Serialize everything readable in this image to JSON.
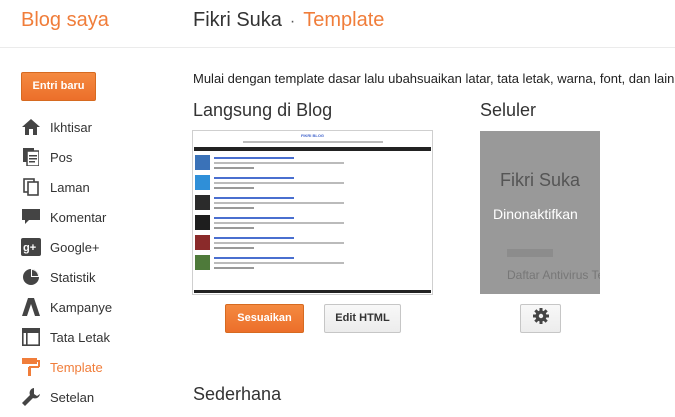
{
  "header": {
    "brand": "Blog saya",
    "blog_name": "Fikri Suka",
    "separator": "·",
    "current_page": "Template"
  },
  "sidebar": {
    "new_post_label": "Entri baru",
    "items": [
      {
        "label": "Ikhtisar",
        "icon": "home-icon"
      },
      {
        "label": "Pos",
        "icon": "posts-icon"
      },
      {
        "label": "Laman",
        "icon": "pages-icon"
      },
      {
        "label": "Komentar",
        "icon": "comment-icon"
      },
      {
        "label": "Google+",
        "icon": "google-plus-icon"
      },
      {
        "label": "Statistik",
        "icon": "pie-chart-icon"
      },
      {
        "label": "Kampanye",
        "icon": "adwords-icon"
      },
      {
        "label": "Tata Letak",
        "icon": "layout-icon"
      },
      {
        "label": "Template",
        "icon": "paint-roller-icon"
      },
      {
        "label": "Setelan",
        "icon": "wrench-icon"
      }
    ],
    "active_item": "Template"
  },
  "main": {
    "intro": "Mulai dengan template dasar lalu ubahsuaikan latar, tata letak, warna, font, dan lain",
    "live_title": "Langsung di Blog",
    "mobile_title": "Seluler",
    "simple_title": "Sederhana",
    "preview": {
      "blog_title": "FIKRI BLOG"
    },
    "mobile_preview": {
      "title": "Fikri Suka",
      "status": "Dinonaktifkan",
      "ghost_text": "kk",
      "link_text": "Daftar Antivirus Te"
    },
    "customize_label": "Sesuaikan",
    "edit_html_label": "Edit HTML",
    "settings_icon": "gear-icon"
  },
  "colors": {
    "accent": "#f07d3a",
    "mobile_overlay": "#999999"
  }
}
